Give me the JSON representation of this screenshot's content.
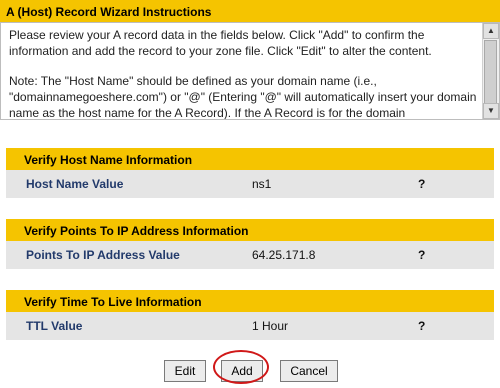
{
  "wizard": {
    "title": "A (Host) Record Wizard Instructions",
    "paragraph1": "Please review your A record data in the fields below. Click \"Add\" to confirm the information and add the record to your zone file. Click \"Edit\" to alter the content.",
    "paragraph2": "Note: The \"Host Name\" should be defined as your domain name (i.e., \"domainnamegoeshere.com\") or \"@\" (Entering \"@\" will automatically insert your domain name as the host name for the A Record). If the A Record is for the domain \"www.domainnamegoeshere.com,\" the host name should be entered as\"www.\""
  },
  "scrollbar": {
    "up_glyph": "▲",
    "down_glyph": "▼"
  },
  "sections": {
    "host": {
      "title": "Verify Host Name Information",
      "label": "Host Name Value",
      "value": "ns1",
      "help": "?"
    },
    "ip": {
      "title": "Verify Points To IP Address Information",
      "label": "Points To IP Address Value",
      "value": "64.25.171.8",
      "help": "?"
    },
    "ttl": {
      "title": "Verify Time To Live Information",
      "label": "TTL Value",
      "value": "1 Hour",
      "help": "?"
    }
  },
  "buttons": {
    "edit": "Edit",
    "add": "Add",
    "cancel": "Cancel"
  }
}
